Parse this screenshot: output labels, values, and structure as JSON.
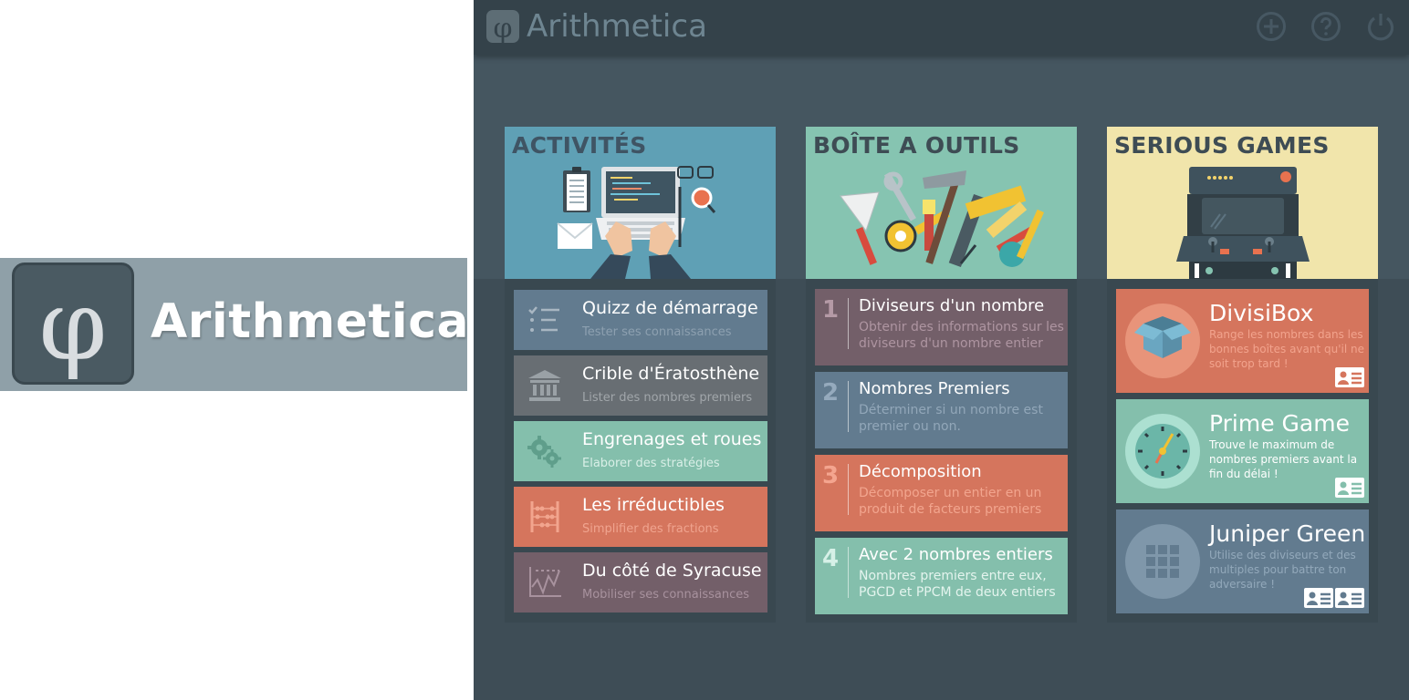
{
  "brand": {
    "symbol": "φ",
    "name": "Arithmetica"
  },
  "app": {
    "title": "Arithmetica",
    "symbol": "φ",
    "toolbar": {
      "add_icon": "plus-circle-icon",
      "help_icon": "question-circle-icon",
      "power_icon": "power-icon"
    }
  },
  "activites": {
    "title": "ACTIVITÉS",
    "color": "#5fa0b5",
    "items": [
      {
        "title": "Quizz de démarrage",
        "subtitle": "Tester ses connaissances",
        "bg": "#627b8f",
        "icon": "checklist-icon"
      },
      {
        "title": "Crible d'Ératosthène",
        "subtitle": "Lister des nombres premiers",
        "bg": "#686e73",
        "icon": "temple-icon"
      },
      {
        "title": "Engrenages et roues",
        "subtitle": "Elaborer des stratégies",
        "bg": "#84bfac",
        "icon": "gears-icon"
      },
      {
        "title": "Les irréductibles",
        "subtitle": "Simplifier des fractions",
        "bg": "#d5755d",
        "icon": "abacus-icon"
      },
      {
        "title": "Du côté de Syracuse",
        "subtitle": "Mobiliser ses connaissances",
        "bg": "#735f69",
        "icon": "chart-icon"
      }
    ]
  },
  "outils": {
    "title": "BOÎTE A OUTILS",
    "color": "#86c4b1",
    "items": [
      {
        "num": "1",
        "title": "Diviseurs d'un nombre",
        "subtitle": "Obtenir des informations sur les diviseurs d'un nombre entier",
        "bg": "#735f69"
      },
      {
        "num": "2",
        "title": "Nombres Premiers",
        "subtitle": "Déterminer si un nombre est premier ou non.",
        "bg": "#627b8f"
      },
      {
        "num": "3",
        "title": "Décomposition",
        "subtitle": "Décomposer un entier en un produit de facteurs premiers",
        "bg": "#d5755d"
      },
      {
        "num": "4",
        "title": "Avec 2 nombres entiers",
        "subtitle": "Nombres premiers entre eux, PGCD et PPCM de deux entiers",
        "bg": "#84bfac"
      }
    ]
  },
  "games": {
    "title": "SERIOUS GAMES",
    "color": "#f1e5ab",
    "items": [
      {
        "title": "DivisiBox",
        "subtitle": "Range les nombres dans les bonnes boîtes avant qu'il ne soit trop tard !",
        "bg": "#d5755d",
        "icon": "box-icon",
        "badges": 1
      },
      {
        "title": "Prime Game",
        "subtitle": "Trouve le maximum de nombres premiers avant la fin du délai !",
        "bg": "#84bfac",
        "icon": "clock-icon",
        "badges": 1
      },
      {
        "title": "Juniper Green",
        "subtitle": "Utilise des diviseurs et des multiples pour battre ton adversaire !",
        "bg": "#627b8f",
        "icon": "grid-icon",
        "badges": 2
      }
    ]
  }
}
